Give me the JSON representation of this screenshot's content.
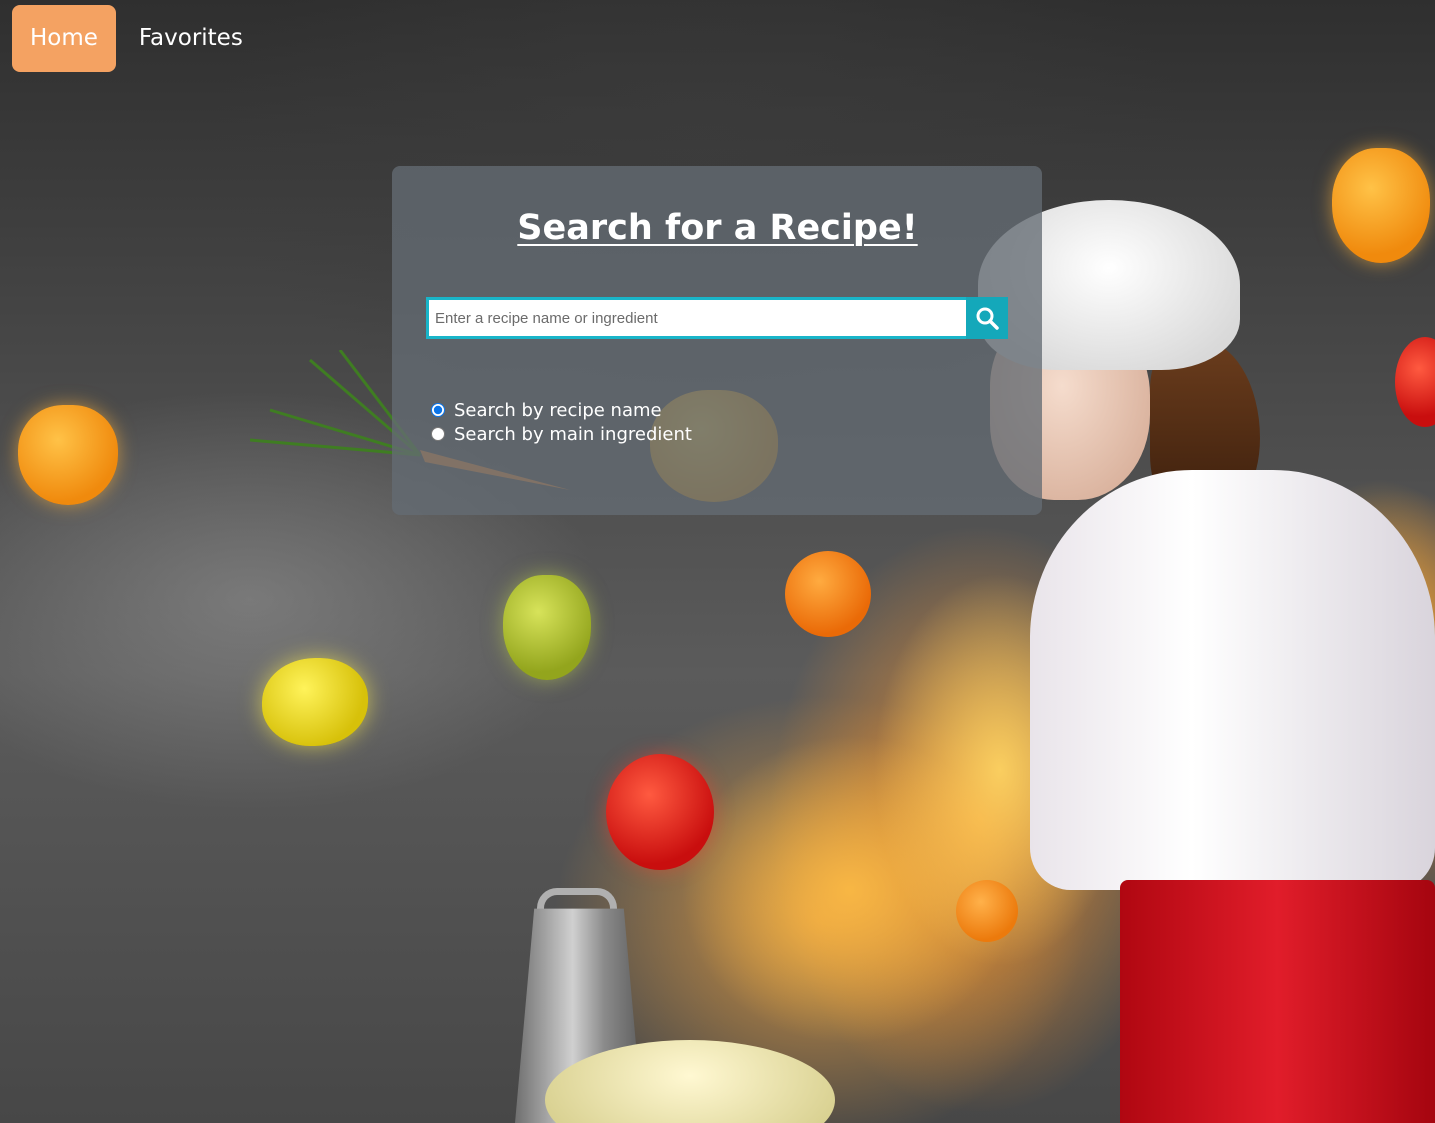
{
  "nav": {
    "items": [
      {
        "label": "Home",
        "active": true
      },
      {
        "label": "Favorites",
        "active": false
      }
    ],
    "active_color": "#f4a262"
  },
  "search": {
    "title": "Search for a Recipe!",
    "placeholder": "Enter a recipe name or ingredient",
    "value": "",
    "button_icon": "search-icon",
    "button_color": "#14a8ba",
    "options": [
      {
        "label": "Search by recipe name",
        "checked": true
      },
      {
        "label": "Search by main ingredient",
        "checked": false
      }
    ]
  },
  "background": {
    "theme_colors": {
      "flame": "#ffb23a",
      "smoke": "#4a4a4a",
      "apron": "#e11d2a"
    }
  }
}
